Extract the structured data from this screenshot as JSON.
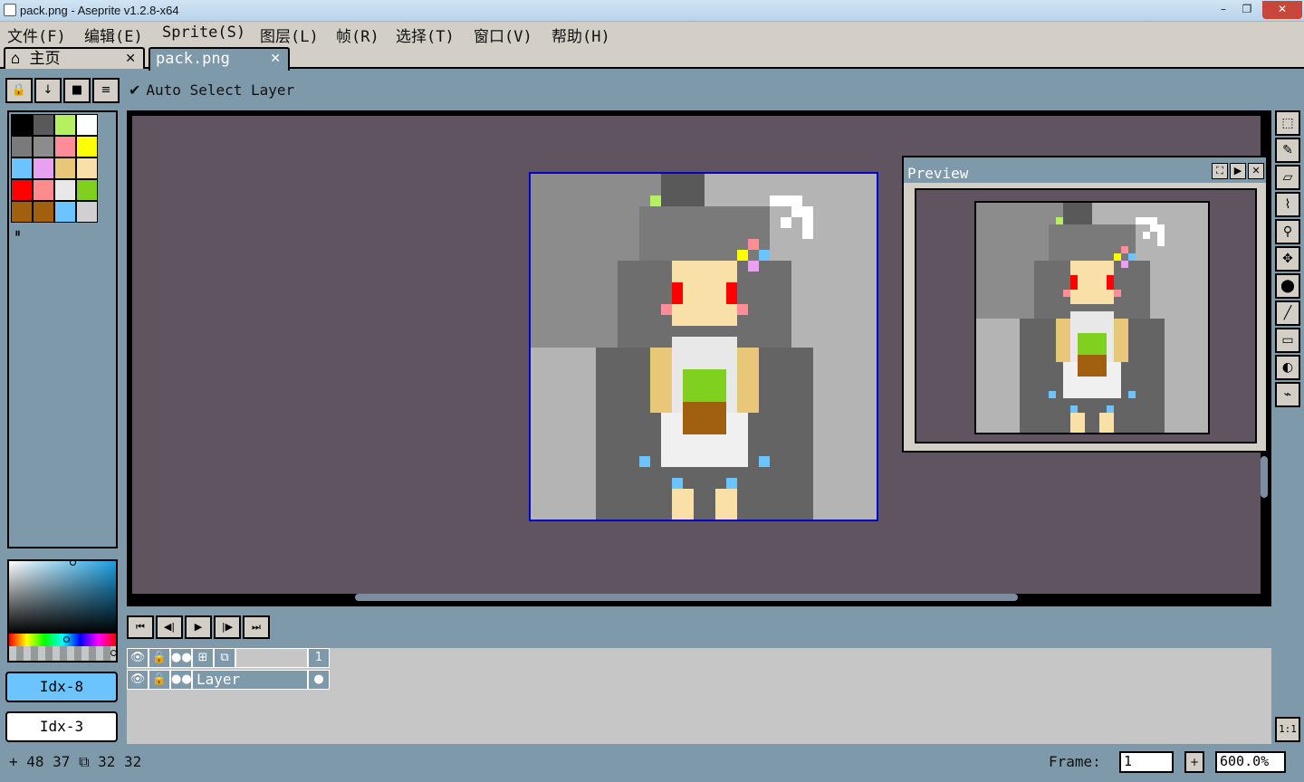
{
  "window": {
    "title": "pack.png - Aseprite v1.2.8-x64",
    "min": "–",
    "max": "❐",
    "close": "✕"
  },
  "menu": [
    "文件(F)",
    "编辑(E)",
    "Sprite(S)",
    "图层(L)",
    "帧(R)",
    "选择(T)",
    "窗口(V)",
    "帮助(H)"
  ],
  "tabs": {
    "home": "主页",
    "home_icon": "⌂",
    "file": "pack.png",
    "close": "✕"
  },
  "context_bar": {
    "buttons": [
      "🔒",
      "↓",
      "■",
      "≡"
    ],
    "auto_select_check": "✔",
    "auto_select_label": "Auto Select Layer"
  },
  "palette": {
    "colors": [
      "#000000",
      "#595959",
      "#b4f060",
      "#ffffff",
      "#7a7a7a",
      "#8c8c8c",
      "#ff8c96",
      "#ffff00",
      "#6cc4ff",
      "#e8a0f0",
      "#e8c878",
      "#f8e0a8",
      "#ff0000",
      "#ff8c8c",
      "#e8e8e8",
      "#80d020",
      "#a06010",
      "#a06010",
      "#6cc4ff",
      "#d0d0d0"
    ],
    "more": "⏸"
  },
  "colors": {
    "fg_label": "Idx-8",
    "bg_label": "Idx-3",
    "fg": "#6cc4ff",
    "bg": "#ffffff"
  },
  "preview": {
    "title": "Preview",
    "buttons": [
      "⛶",
      "▶",
      "✕"
    ]
  },
  "tools": [
    "⬚",
    "✎",
    "▱",
    "⌇",
    "⚲",
    "✥",
    "⬤",
    "╱",
    "▭",
    "◐",
    "⌁"
  ],
  "timeline": {
    "nav": [
      "⏮",
      "◀|",
      "▶",
      "|▶",
      "⏭"
    ],
    "header_icons": [
      "👁",
      "🔒",
      "●●",
      "⊞",
      "⧉"
    ],
    "frame_number": "1",
    "layer_icons": [
      "👁",
      "🔒",
      "●●"
    ],
    "layer_name": "Layer",
    "cel": "●",
    "zoom_1_1": "1:1"
  },
  "status": {
    "position": "+ 48  37 ⧉ 32  32",
    "frame_label": "Frame:",
    "frame_value": "1",
    "frame_plus": "+",
    "zoom": "600.0%"
  }
}
